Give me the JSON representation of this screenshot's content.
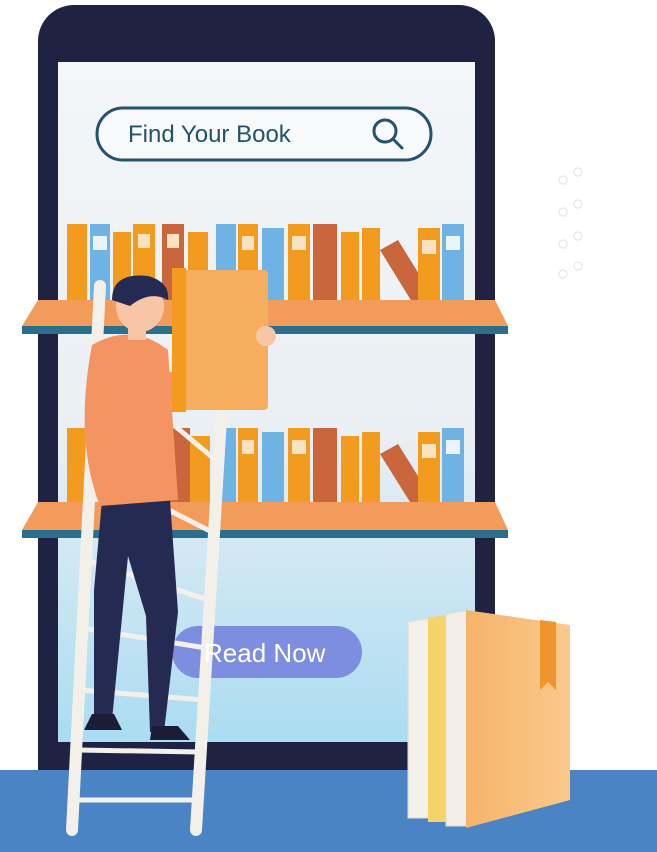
{
  "search": {
    "label": "Find Your Book",
    "icon": "search-icon"
  },
  "cta": {
    "label": "Read Now"
  },
  "colors": {
    "phone_frame": "#1f2242",
    "screen_top": "#f2f5f7",
    "screen_bottom": "#aedff4",
    "shelf": "#f39b5a",
    "shelf_edge": "#2c6f8c",
    "floor": "#4a84c4",
    "book_orange": "#f39b1e",
    "book_blue": "#6fb2e4",
    "book_rust": "#c9663b",
    "person_shirt": "#f39462",
    "person_pants": "#242a52",
    "ladder": "#f3f0ea",
    "read_now_button": "#7d8ee0"
  }
}
